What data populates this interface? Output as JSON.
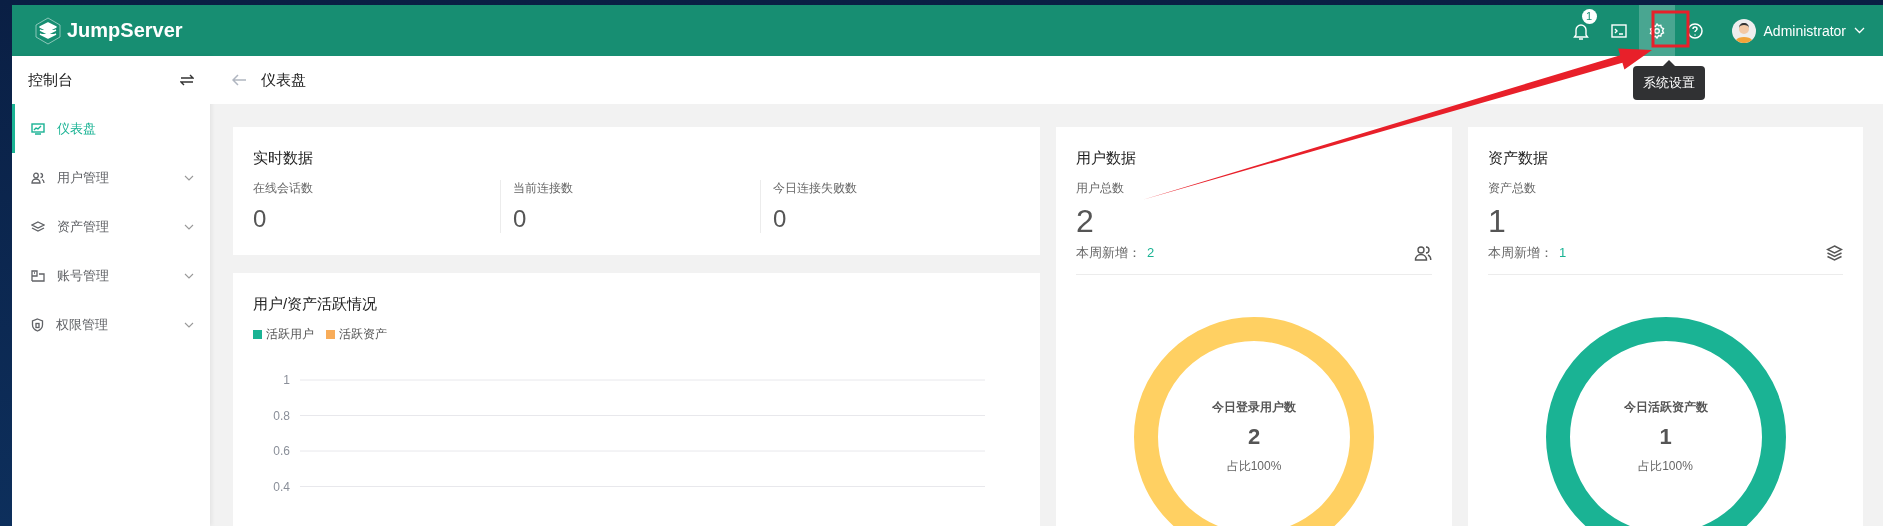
{
  "brand": {
    "name": "JumpServer"
  },
  "header": {
    "notification_badge": "1",
    "tooltip": "系统设置",
    "user": "Administrator"
  },
  "sidebar": {
    "title": "控制台",
    "items": [
      {
        "label": "仪表盘",
        "selected": true,
        "kind": "link"
      },
      {
        "label": "用户管理",
        "selected": false,
        "kind": "group"
      },
      {
        "label": "资产管理",
        "selected": false,
        "kind": "group"
      },
      {
        "label": "账号管理",
        "selected": false,
        "kind": "group"
      },
      {
        "label": "权限管理",
        "selected": false,
        "kind": "group"
      }
    ]
  },
  "page": {
    "title": "仪表盘"
  },
  "realtime": {
    "title": "实时数据",
    "metrics": [
      {
        "label": "在线会话数",
        "value": "0"
      },
      {
        "label": "当前连接数",
        "value": "0"
      },
      {
        "label": "今日连接失败数",
        "value": "0"
      }
    ]
  },
  "activity": {
    "title": "用户/资产活跃情况",
    "chart_data": {
      "type": "line",
      "ylim": [
        0.4,
        1
      ],
      "grid": true,
      "yticks": [
        0.4,
        0.6,
        0.8,
        1
      ],
      "series": [
        {
          "name": "活跃用户",
          "color": "#1ab394"
        },
        {
          "name": "活跃资产",
          "color": "#f8ac59"
        }
      ]
    }
  },
  "stats": [
    {
      "title": "用户数据",
      "total_label": "用户总数",
      "total": "2",
      "weekly_label": "本周新增：",
      "weekly": "2",
      "donut": {
        "label": "今日登录用户数",
        "value": "2",
        "share": "占比100%",
        "color": "#ffd062"
      }
    },
    {
      "title": "资产数据",
      "total_label": "资产总数",
      "total": "1",
      "weekly_label": "本周新增：",
      "weekly": "1",
      "donut": {
        "label": "今日活跃资产数",
        "value": "1",
        "share": "占比100%",
        "color": "#1ab394"
      }
    }
  ]
}
